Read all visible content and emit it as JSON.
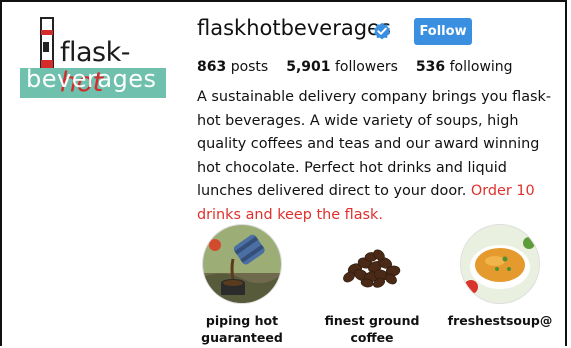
{
  "logo": {
    "word_flask": "flask",
    "word_hot": "hot",
    "word_beverages": "beverages"
  },
  "profile": {
    "username": "flaskhotbeverages",
    "follow_label": "Follow"
  },
  "stats": {
    "posts_count": "863",
    "posts_label": "posts",
    "followers_count": "5,901",
    "followers_label": "followers",
    "following_count": "536",
    "following_label": "following"
  },
  "bio": {
    "text": "A sustainable delivery company brings you flask-hot beverages. A wide variety of soups, high quality coffees and teas and our award winning hot chocolate. Perfect hot drinks and liquid lunches delivered direct to your door.",
    "promo": "Order 10 drinks and keep the flask."
  },
  "highlights": [
    {
      "label": "piping hot guaranteed",
      "icon": "flask-pour-image"
    },
    {
      "label": "finest ground coffee",
      "icon": "coffee-beans-image"
    },
    {
      "label": "freshestsoup@",
      "icon": "soup-bowl-image"
    }
  ],
  "colors": {
    "accent": "#3a8fe0",
    "promo": "#e0302b",
    "logo_band": "#6fc0ad",
    "logo_hot": "#d42b2b"
  }
}
